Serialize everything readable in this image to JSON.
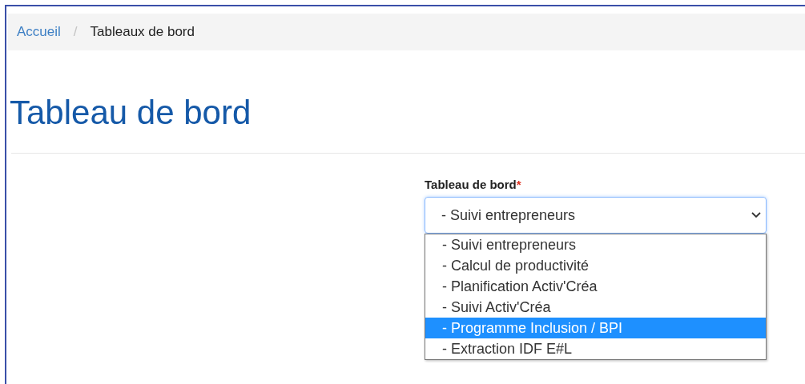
{
  "breadcrumb": [
    {
      "label": "Accueil",
      "kind": "link"
    },
    {
      "label": "/",
      "kind": "separator"
    },
    {
      "label": "Tableaux de bord",
      "kind": "current"
    }
  ],
  "page_title": "Tableau de bord",
  "field": {
    "label": "Tableau de bord",
    "required_mark": "*",
    "value": "- Suivi entrepreneurs",
    "expanded": true,
    "options": [
      {
        "label": "- Suivi entrepreneurs",
        "highlighted": false
      },
      {
        "label": "- Calcul de productivité",
        "highlighted": false
      },
      {
        "label": "- Planification Activ'Créa",
        "highlighted": false
      },
      {
        "label": "- Suivi Activ'Créa",
        "highlighted": false
      },
      {
        "label": "- Programme Inclusion / BPI",
        "highlighted": true
      },
      {
        "label": "- Extraction IDF E#L",
        "highlighted": false
      }
    ]
  }
}
